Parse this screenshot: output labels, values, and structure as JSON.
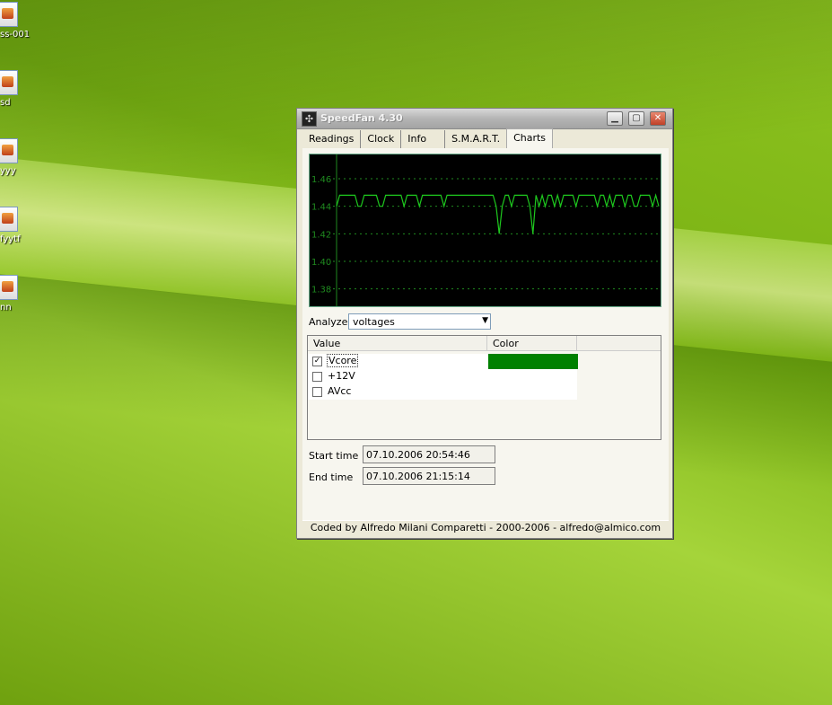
{
  "desktop": {
    "icons": [
      {
        "label": "ss-001"
      },
      {
        "label": "sd"
      },
      {
        "label": "yyy"
      },
      {
        "label": "fyytf"
      },
      {
        "label": "nn"
      }
    ]
  },
  "window": {
    "title": "SpeedFan 4.30",
    "tabs": [
      "Readings",
      "Clock",
      "Info",
      "S.M.A.R.T.",
      "Charts"
    ],
    "active_tab": "Charts"
  },
  "chart_data": {
    "type": "line",
    "title": "",
    "xlabel": "",
    "ylabel": "",
    "ylim": [
      1.37,
      1.475
    ],
    "yticks": [
      "1.46",
      "1.44",
      "1.42",
      "1.40",
      "1.38"
    ],
    "grid": true,
    "background": "#000000",
    "grid_color": "#1f8a1f",
    "series": [
      {
        "name": "Vcore",
        "color": "#1ec81e",
        "values": [
          1.44,
          1.448,
          1.448,
          1.448,
          1.448,
          1.448,
          1.448,
          1.44,
          1.44,
          1.448,
          1.448,
          1.448,
          1.448,
          1.448,
          1.44,
          1.44,
          1.448,
          1.448,
          1.448,
          1.448,
          1.448,
          1.448,
          1.44,
          1.448,
          1.448,
          1.448,
          1.448,
          1.44,
          1.448,
          1.448,
          1.448,
          1.448,
          1.448,
          1.448,
          1.448,
          1.44,
          1.448,
          1.448,
          1.448,
          1.448,
          1.448,
          1.448,
          1.448,
          1.448,
          1.448,
          1.448,
          1.448,
          1.448,
          1.448,
          1.448,
          1.448,
          1.448,
          1.44,
          1.42,
          1.44,
          1.448,
          1.448,
          1.44,
          1.448,
          1.448,
          1.448,
          1.448,
          1.448,
          1.44,
          1.42,
          1.448,
          1.44,
          1.448,
          1.44,
          1.448,
          1.448,
          1.44,
          1.448,
          1.44,
          1.448,
          1.448,
          1.448,
          1.448,
          1.44,
          1.448,
          1.448,
          1.448,
          1.448,
          1.448,
          1.448,
          1.44,
          1.448,
          1.448,
          1.44,
          1.448,
          1.44,
          1.448,
          1.448,
          1.448,
          1.44,
          1.448,
          1.448,
          1.44,
          1.44,
          1.448,
          1.448,
          1.448,
          1.448,
          1.44,
          1.448,
          1.44
        ]
      }
    ]
  },
  "analyze": {
    "label": "Analyze",
    "selected": "voltages"
  },
  "listview": {
    "columns": [
      "Value",
      "Color"
    ],
    "rows": [
      {
        "label": "Vcore",
        "checked": true,
        "color": "#008000"
      },
      {
        "label": "+12V",
        "checked": false,
        "color": ""
      },
      {
        "label": "AVcc",
        "checked": false,
        "color": ""
      }
    ]
  },
  "times": {
    "start_label": "Start time",
    "start_value": "07.10.2006 20:54:46",
    "end_label": "End time",
    "end_value": "07.10.2006 21:15:14"
  },
  "footer": "Coded by Alfredo Milani Comparetti - 2000-2006 - alfredo@almico.com"
}
